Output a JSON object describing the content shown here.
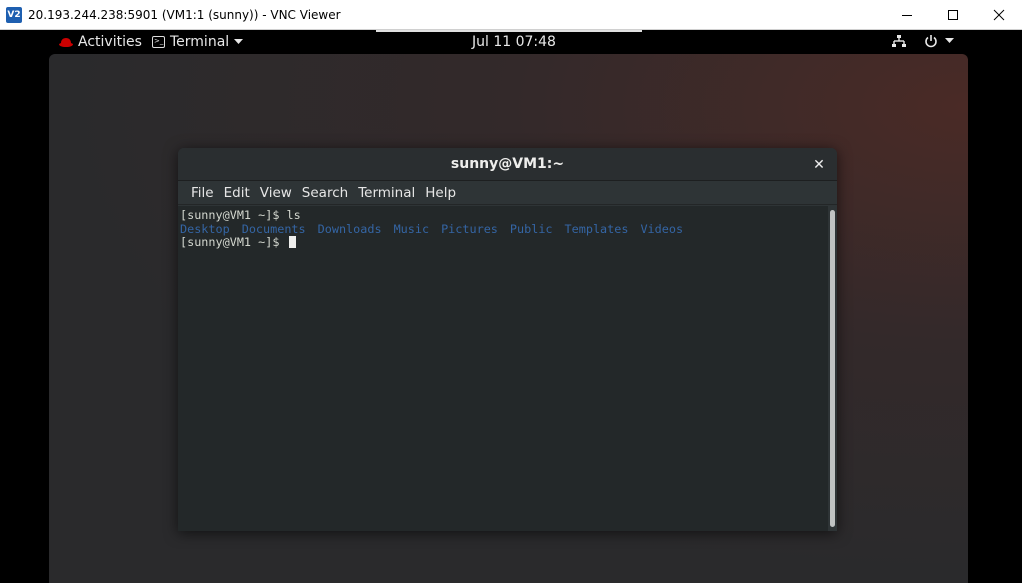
{
  "vnc": {
    "logo": "V2",
    "title": "20.193.244.238:5901 (VM1:1 (sunny)) - VNC Viewer"
  },
  "gnome": {
    "activities": "Activities",
    "app_menu": "Terminal",
    "clock": "Jul 11  07:48"
  },
  "terminal": {
    "title": "sunny@VM1:~",
    "menu": [
      "File",
      "Edit",
      "View",
      "Search",
      "Terminal",
      "Help"
    ],
    "prompt1": "[sunny@VM1 ~]$ ls",
    "directories": [
      "Desktop",
      "Documents",
      "Downloads",
      "Music",
      "Pictures",
      "Public",
      "Templates",
      "Videos"
    ],
    "prompt2": "[sunny@VM1 ~]$ "
  },
  "colors": {
    "directory_blue": "#3465a4",
    "redhat_red": "#cc0000"
  },
  "icons": [
    "redhat-logo-icon",
    "terminal-app-icon",
    "network-wired-icon",
    "power-icon",
    "minimize-icon",
    "maximize-icon",
    "close-icon"
  ]
}
